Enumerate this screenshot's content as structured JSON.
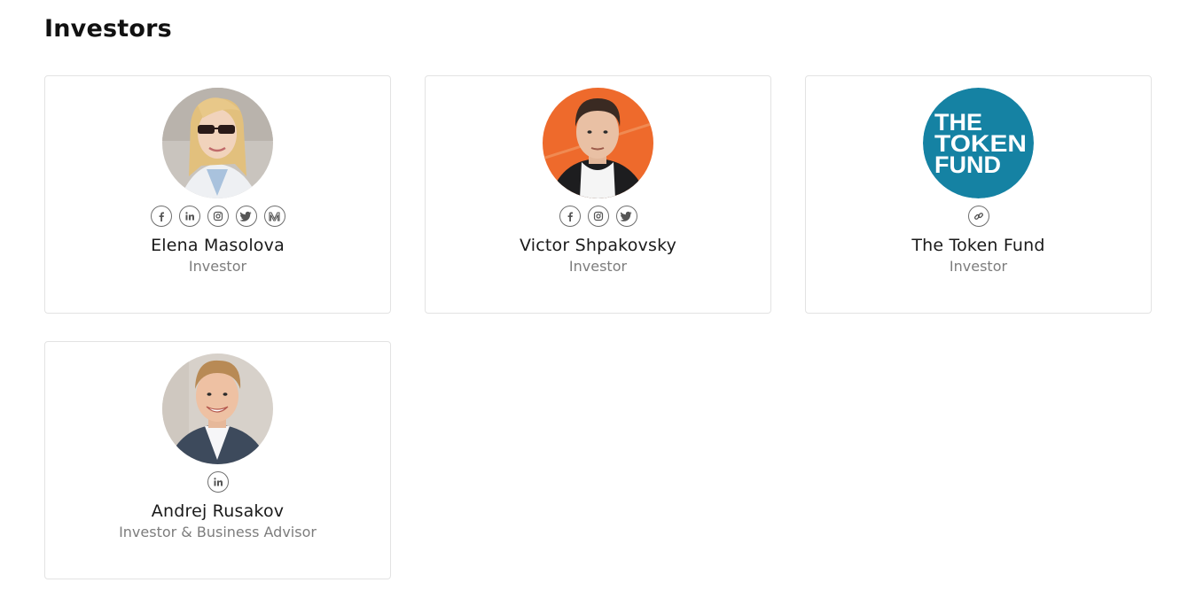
{
  "page": {
    "title": "Investors"
  },
  "investors": [
    {
      "name": "Elena Masolova",
      "role": "Investor",
      "socials": [
        "facebook-icon",
        "linkedin-icon",
        "instagram-icon",
        "twitter-icon",
        "medium-icon"
      ]
    },
    {
      "name": "Victor Shpakovsky",
      "role": "Investor",
      "socials": [
        "facebook-icon",
        "instagram-icon",
        "twitter-icon"
      ]
    },
    {
      "name": "The Token Fund",
      "role": "Investor",
      "logo_text": [
        "THE",
        "TOKEN",
        "FUND"
      ],
      "socials": [
        "link-icon"
      ]
    },
    {
      "name": "Andrej Rusakov",
      "role": "Investor & Business Advisor",
      "socials": [
        "linkedin-icon"
      ]
    }
  ],
  "colors": {
    "token_fund_brand": "#1582a3",
    "card_border": "#e3e3e3",
    "role_text": "#7d7d7d",
    "icon_stroke": "#6f6f6f"
  }
}
